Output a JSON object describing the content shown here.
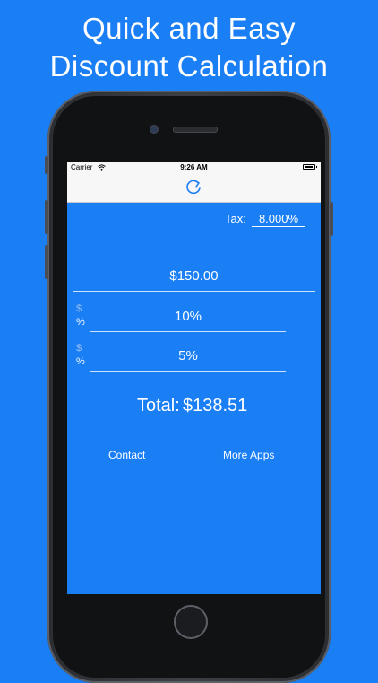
{
  "headline": {
    "line1": "Quick and Easy",
    "line2": "Discount Calculation"
  },
  "status_bar": {
    "carrier": "Carrier",
    "time": "9:26 AM"
  },
  "tax": {
    "label": "Tax:",
    "value": "8.000%"
  },
  "price": {
    "value": "$150.00"
  },
  "discounts": [
    {
      "dollar_symbol": "$",
      "percent_symbol": "%",
      "value": "10%"
    },
    {
      "dollar_symbol": "$",
      "percent_symbol": "%",
      "value": "5%"
    }
  ],
  "total": {
    "label": "Total:",
    "value": "$138.51"
  },
  "links": {
    "contact": "Contact",
    "more_apps": "More Apps"
  },
  "colors": {
    "background": "#1a7ef5",
    "text": "#ffffff",
    "nav_bar": "#f7f7f7",
    "refresh_icon": "#1a7ef5"
  },
  "icons": {
    "refresh": "refresh-icon",
    "wifi": "wifi-icon",
    "battery": "battery-icon"
  }
}
